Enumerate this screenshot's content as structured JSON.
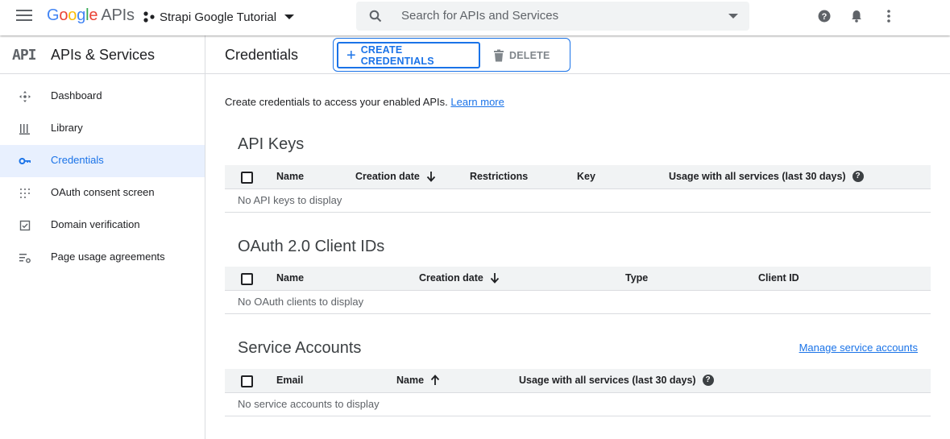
{
  "topbar": {
    "logo_letters": [
      "G",
      "o",
      "o",
      "g",
      "l",
      "e"
    ],
    "logo_suffix": "APIs",
    "project_name": "Strapi Google Tutorial",
    "search_placeholder": "Search for APIs and Services",
    "icons": [
      "menu-icon",
      "project-dots-icon",
      "search-icon",
      "help-icon",
      "notifications-icon",
      "more-vert-icon"
    ]
  },
  "sidebar": {
    "logo_mark": "API",
    "title": "APIs & Services",
    "items": [
      {
        "label": "Dashboard",
        "icon": "dashboard-icon"
      },
      {
        "label": "Library",
        "icon": "library-icon"
      },
      {
        "label": "Credentials",
        "icon": "key-icon",
        "active": true
      },
      {
        "label": "OAuth consent screen",
        "icon": "oauth-consent-icon"
      },
      {
        "label": "Domain verification",
        "icon": "domain-check-icon"
      },
      {
        "label": "Page usage agreements",
        "icon": "settings-list-icon"
      }
    ]
  },
  "main": {
    "title": "Credentials",
    "create_label": "CREATE CREDENTIALS",
    "delete_label": "DELETE",
    "intro_text": "Create credentials to access your enabled APIs.",
    "learn_more": "Learn more",
    "api_keys": {
      "title": "API Keys",
      "columns": [
        "Name",
        "Creation date",
        "Restrictions",
        "Key",
        "Usage with all services (last 30 days)"
      ],
      "empty": "No API keys to display"
    },
    "oauth": {
      "title": "OAuth 2.0 Client IDs",
      "columns": [
        "Name",
        "Creation date",
        "Type",
        "Client ID"
      ],
      "empty": "No OAuth clients to display"
    },
    "service_accounts": {
      "title": "Service Accounts",
      "manage_link": "Manage service accounts",
      "columns": [
        "Email",
        "Name",
        "Usage with all services (last 30 days)"
      ],
      "empty": "No service accounts to display"
    }
  },
  "colors": {
    "accent": "#1a73e8",
    "active_bg": "#e8f0fe",
    "table_header_bg": "#f1f3f4",
    "divider": "#dadce0"
  }
}
